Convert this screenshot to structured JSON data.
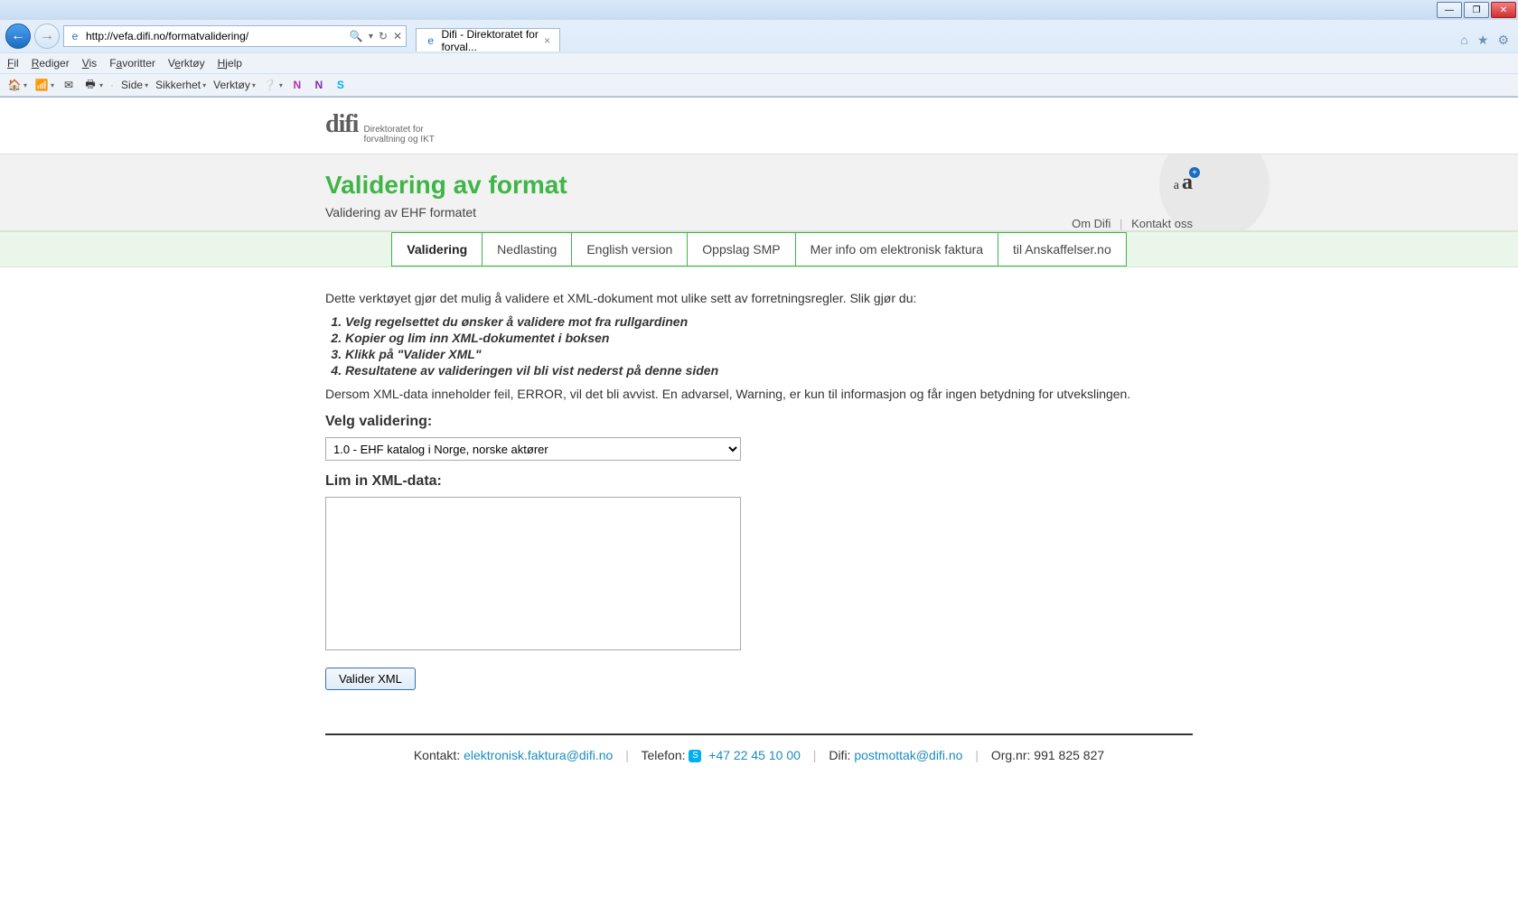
{
  "browser": {
    "url": "http://vefa.difi.no/formatvalidering/",
    "tab_title": "Difi - Direktoratet for forval...",
    "menus": [
      "Fil",
      "Rediger",
      "Vis",
      "Favoritter",
      "Verktøy",
      "Hjelp"
    ],
    "toolbar_items": [
      "Side",
      "Sikkerhet",
      "Verktøy"
    ]
  },
  "logo": {
    "main": "difi",
    "sub1": "Direktoratet for",
    "sub2": "forvaltning og IKT"
  },
  "header": {
    "title": "Validering av format",
    "subtitle": "Validering av EHF formatet",
    "text_small": "a",
    "text_large": "a",
    "link_om": "Om Difi",
    "link_kontakt": "Kontakt oss"
  },
  "nav": {
    "tabs": [
      {
        "label": "Validering",
        "active": true
      },
      {
        "label": "Nedlasting",
        "active": false
      },
      {
        "label": "English version",
        "active": false
      },
      {
        "label": "Oppslag SMP",
        "active": false
      },
      {
        "label": "Mer info om elektronisk faktura",
        "active": false
      },
      {
        "label": "til Anskaffelser.no",
        "active": false
      }
    ]
  },
  "content": {
    "intro": "Dette verktøyet gjør det mulig å validere et XML-dokument mot ulike sett av forretningsregler. Slik gjør du:",
    "steps": [
      "Velg regelsettet du ønsker å validere mot fra rullgardinen",
      "Kopier og lim inn XML-dokumentet i boksen",
      "Klikk på \"Valider XML\"",
      "Resultatene av valideringen vil bli vist nederst på denne siden"
    ],
    "note": "Dersom XML-data inneholder feil, ERROR, vil det bli avvist. En advarsel, Warning, er kun til informasjon og får ingen betydning for utvekslingen.",
    "select_label": "Velg validering:",
    "select_value": "1.0 - EHF katalog i Norge, norske aktører",
    "xml_label": "Lim in XML-data:",
    "button": "Valider XML"
  },
  "footer": {
    "kontakt_label": "Kontakt:",
    "kontakt_email": "elektronisk.faktura@difi.no",
    "telefon_label": "Telefon:",
    "telefon": "+47 22 45 10 00",
    "difi_label": "Difi:",
    "difi_email": "postmottak@difi.no",
    "orgnr_label": "Org.nr:",
    "orgnr": "991 825 827"
  }
}
